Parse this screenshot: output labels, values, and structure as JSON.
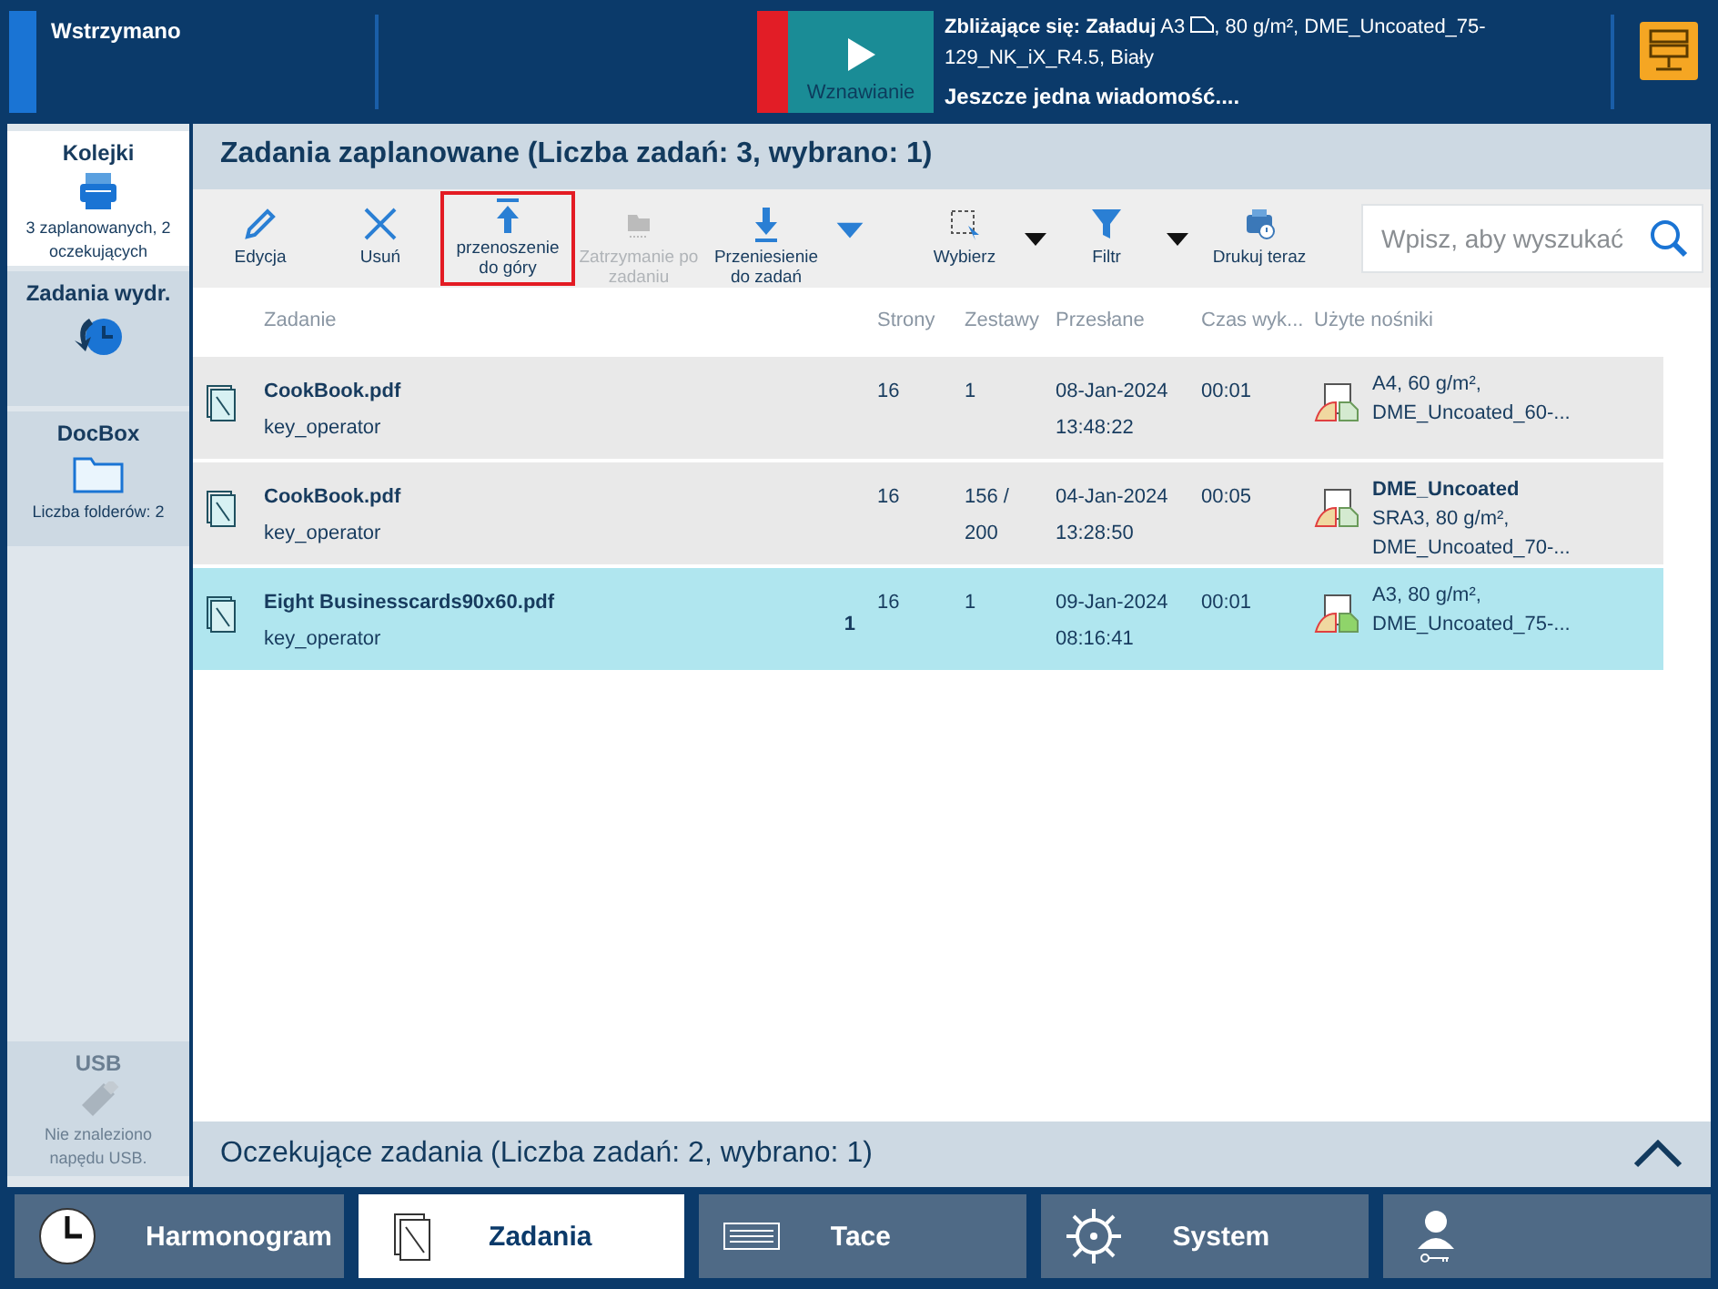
{
  "status_bar": {
    "state": "Wstrzymano",
    "resume_button": "Wznawianie",
    "upcoming_label": "Zbliżające się: Załaduj",
    "upcoming_size": "A3",
    "upcoming_detail": [
      ", 80 g/m², DME_Uncoated_75-",
      "129_NK_iX_R4.5, Biały"
    ],
    "message": "Jeszcze jedna wiadomość...."
  },
  "sidebar": {
    "items": [
      {
        "title": "Kolejki",
        "subtitle": "3 zaplanowanych, 2 oczekujących",
        "selected": true,
        "disabled": false
      },
      {
        "title": "Zadania wydr.",
        "selected": false,
        "disabled": false
      },
      {
        "title": "DocBox",
        "subtitle": "Liczba folderów: 2",
        "selected": false,
        "disabled": false
      }
    ],
    "usb": {
      "title": "USB",
      "subtitle": "Nie znaleziono napędu USB.",
      "disabled": true
    }
  },
  "scheduled": {
    "title": "Zadania zaplanowane (Liczba zadań: 3, wybrano: 1)",
    "toolbar": [
      {
        "label": "Edycja",
        "disabled": false,
        "highlighted": false,
        "dropdown": false
      },
      {
        "label": "Usuń",
        "disabled": false,
        "highlighted": false,
        "dropdown": false
      },
      {
        "label": "przenoszenie do góry",
        "disabled": false,
        "highlighted": true,
        "dropdown": false
      },
      {
        "label": "Zatrzymanie po zadaniu",
        "disabled": true,
        "highlighted": false,
        "dropdown": false
      },
      {
        "label": "Przeniesienie do zadań",
        "disabled": false,
        "highlighted": false,
        "dropdown": true
      },
      {
        "label": "Wybierz",
        "disabled": false,
        "highlighted": false,
        "dropdown": true
      },
      {
        "label": "Filtr",
        "disabled": false,
        "highlighted": false,
        "dropdown": true
      },
      {
        "label": "Drukuj teraz",
        "disabled": false,
        "highlighted": false,
        "dropdown": false
      }
    ],
    "search": {
      "placeholder": "Wpisz, aby wyszukać"
    },
    "columns": [
      "Zadanie",
      "Strony",
      "Zestawy",
      "Przesłane",
      "Czas wyk...",
      "Użyte nośniki"
    ],
    "rows": [
      {
        "name": "CookBook.pdf",
        "owner": "key_operator",
        "pages": "16",
        "sets": [
          "1"
        ],
        "date": "08-Jan-2024",
        "time": "13:48:22",
        "duration": "00:01",
        "media": [
          "A4, 60 g/m²,",
          "DME_Uncoated_60-..."
        ],
        "selected": false
      },
      {
        "name": "CookBook.pdf",
        "owner": "key_operator",
        "pages": "16",
        "sets": [
          "156 /",
          "200"
        ],
        "date": "04-Jan-2024",
        "time": "13:28:50",
        "duration": "00:05",
        "media_title": "DME_Uncoated",
        "media": [
          "SRA3, 80 g/m²,",
          "DME_Uncoated_70-..."
        ],
        "selected": false
      },
      {
        "name": "Eight Businesscards90x60.pdf",
        "owner": "key_operator",
        "badge": "1",
        "pages": "16",
        "sets": [
          "1"
        ],
        "date": "09-Jan-2024",
        "time": "08:16:41",
        "duration": "00:01",
        "media": [
          "A3, 80 g/m²,",
          "DME_Uncoated_75-..."
        ],
        "selected": true
      }
    ]
  },
  "waiting": {
    "title": "Oczekujące zadania (Liczba zadań: 2, wybrano: 1)",
    "expanded": false
  },
  "nav": [
    {
      "label": "Harmonogram",
      "selected": false
    },
    {
      "label": "Zadania",
      "selected": true
    },
    {
      "label": "Tace",
      "selected": false
    },
    {
      "label": "System",
      "selected": false
    },
    {
      "selected": false
    }
  ]
}
